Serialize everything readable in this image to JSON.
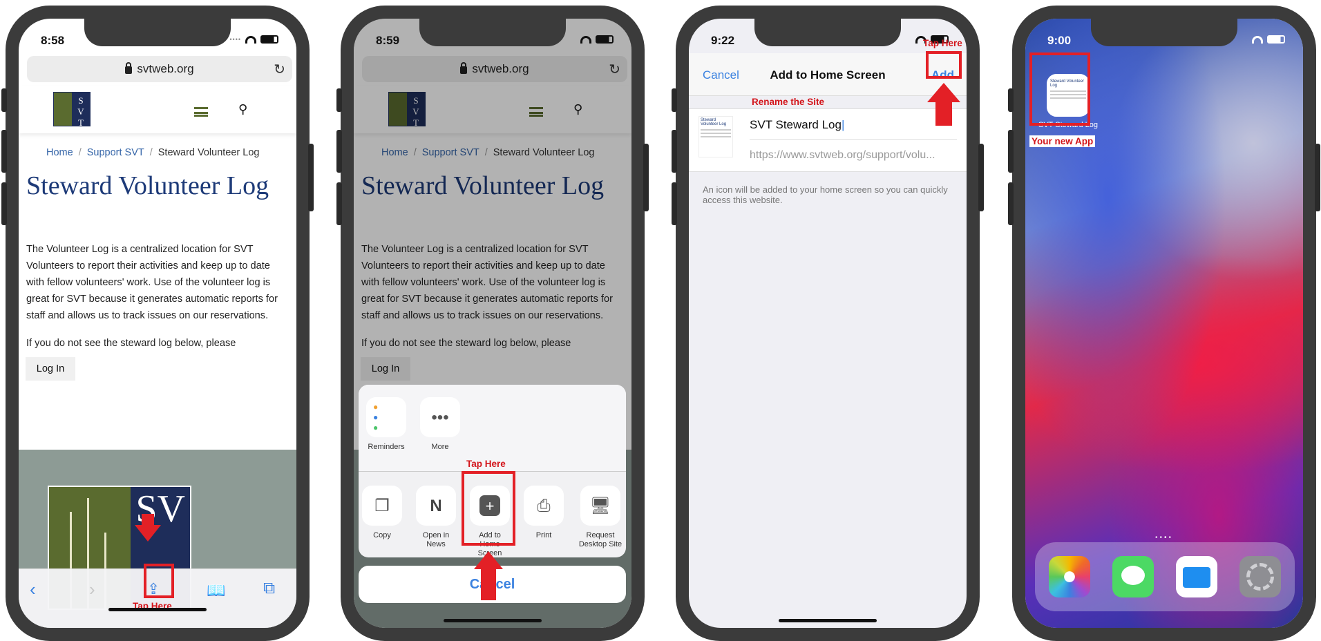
{
  "phone1": {
    "time": "8:58",
    "url": "svtweb.org",
    "logo_text": "S\nV\nT",
    "breadcrumb": [
      "Home",
      "Support SVT",
      "Steward Volunteer Log"
    ],
    "title": "Steward Volunteer Log",
    "paragraph": "The Volunteer Log is a centralized location for SVT Volunteers to report their activities and keep up to date with fellow volunteers' work. Use of the volunteer log is great for SVT because it generates automatic reports for staff and allows us to track issues on our reservations.",
    "login_prompt": "If you do not see the steward log below, please",
    "login_button": "Log In",
    "big_logo_text": "SV",
    "toolbar": {
      "back": "‹",
      "forward": "›",
      "share": "⇪",
      "bookmarks": "📖",
      "tabs": "⧉"
    },
    "annotation": "Tap Here"
  },
  "phone2": {
    "time": "8:59",
    "url": "svtweb.org",
    "breadcrumb": [
      "Home",
      "Support SVT",
      "Steward Volunteer Log"
    ],
    "title": "Steward Volunteer Log",
    "paragraph": "The Volunteer Log is a centralized location for SVT Volunteers to report their activities and keep up to date with fellow volunteers' work. Use of the volunteer log is great for SVT because it generates automatic reports for staff and allows us to track issues on our reservations.",
    "login_prompt": "If you do not see the steward log below, please",
    "login_button": "Log In",
    "share_row1": [
      {
        "label": "Reminders",
        "icon": "reminders-icon"
      },
      {
        "label": "More",
        "icon": "more-icon"
      }
    ],
    "share_row2": [
      {
        "label": "Copy",
        "icon": "copy-icon"
      },
      {
        "label": "Open in News",
        "icon": "news-icon"
      },
      {
        "label": "Add to Home Screen",
        "icon": "add-icon"
      },
      {
        "label": "Print",
        "icon": "print-icon"
      },
      {
        "label": "Request Desktop Site",
        "icon": "desktop-icon"
      }
    ],
    "cancel": "Cancel",
    "annotation": "Tap Here"
  },
  "phone3": {
    "time": "9:22",
    "cancel": "Cancel",
    "nav_title": "Add to Home Screen",
    "add": "Add",
    "site_name": "SVT Steward Log",
    "site_url": "https://www.svtweb.org/support/volu...",
    "hint": "An icon will be added to your home screen so you can quickly access this website.",
    "thumb_title": "Steward Volunteer Log",
    "annotation_add": "Tap Here",
    "annotation_rename": "Rename the Site"
  },
  "phone4": {
    "time": "9:00",
    "app_label": "SVT Steward Log",
    "thumb_title": "Steward Volunteer Log",
    "annotation": "Your new App",
    "dock": [
      "photos-icon",
      "messages-icon",
      "files-icon",
      "settings-icon"
    ]
  },
  "colors": {
    "accent": "#3b82e0",
    "annotation": "#e32026",
    "title": "#1d3a78",
    "link": "#3565a8",
    "olive": "#5a6b2f",
    "navy": "#1e2d5a"
  }
}
